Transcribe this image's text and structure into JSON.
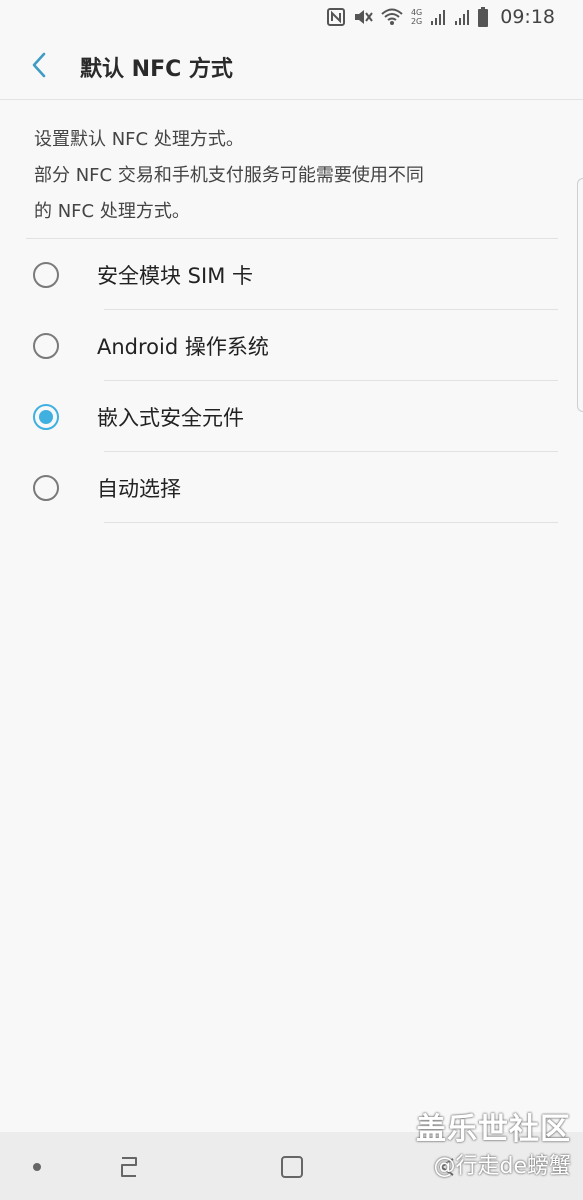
{
  "status_bar": {
    "time": "09:18",
    "icons": [
      "nfc-icon",
      "mute-icon",
      "wifi-icon",
      "network-4g-icon",
      "signal-icon",
      "signal-icon",
      "battery-icon"
    ],
    "network_top": "4G",
    "network_bottom": "2G"
  },
  "header": {
    "title": "默认 NFC 方式",
    "back_icon": "chevron-left-icon"
  },
  "description": {
    "lines": [
      "设置默认 NFC 处理方式。",
      "部分 NFC 交易和手机支付服务可能需要使用不同",
      "的 NFC 处理方式。"
    ]
  },
  "options": [
    {
      "label": "安全模块 SIM 卡",
      "selected": false
    },
    {
      "label": "Android 操作系统",
      "selected": false
    },
    {
      "label": "嵌入式安全元件",
      "selected": true
    },
    {
      "label": "自动选择",
      "selected": false
    }
  ],
  "nav_bar": {
    "icons": [
      "dot-icon",
      "recents-icon",
      "home-icon",
      "back-icon"
    ]
  },
  "watermark": {
    "title": "盖乐世社区",
    "author": "@行走de螃蟹"
  },
  "colors": {
    "accent": "#3fb0e0",
    "background": "#f8f8f8",
    "nav_background": "#ececec"
  }
}
